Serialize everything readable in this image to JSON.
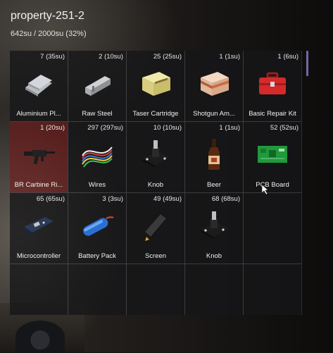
{
  "header": {
    "title": "property-251-2",
    "capacity": "642su / 2000su (32%)"
  },
  "items": [
    {
      "qty": "7 (35su)",
      "name": "Aluminium Pl...",
      "icon": "aluminium-plate-icon"
    },
    {
      "qty": "2 (10su)",
      "name": "Raw Steel",
      "icon": "raw-steel-icon"
    },
    {
      "qty": "25 (25su)",
      "name": "Taser Cartridge",
      "icon": "taser-cartridge-icon"
    },
    {
      "qty": "1 (1su)",
      "name": "Shotgun Am...",
      "icon": "shotgun-ammo-icon"
    },
    {
      "qty": "1 (6su)",
      "name": "Basic Repair Kit",
      "icon": "repair-kit-icon"
    },
    {
      "qty": "1 (20su)",
      "name": "BR Carbine Ri...",
      "icon": "carbine-rifle-icon"
    },
    {
      "qty": "297 (297su)",
      "name": "Wires",
      "icon": "wires-icon"
    },
    {
      "qty": "10 (10su)",
      "name": "Knob",
      "icon": "knob-icon"
    },
    {
      "qty": "1 (1su)",
      "name": "Beer",
      "icon": "beer-icon"
    },
    {
      "qty": "52 (52su)",
      "name": "PCB Board",
      "icon": "pcb-board-icon"
    },
    {
      "qty": "65 (65su)",
      "name": "Microcontroller",
      "icon": "microcontroller-icon"
    },
    {
      "qty": "3 (3su)",
      "name": "Battery Pack",
      "icon": "battery-pack-icon"
    },
    {
      "qty": "49 (49su)",
      "name": "Screen",
      "icon": "screen-icon"
    },
    {
      "qty": "68 (68su)",
      "name": "Knob",
      "icon": "knob-icon"
    }
  ],
  "colors": {
    "scrollbar": "#6d6aa6",
    "selected_slot": "#781818"
  }
}
